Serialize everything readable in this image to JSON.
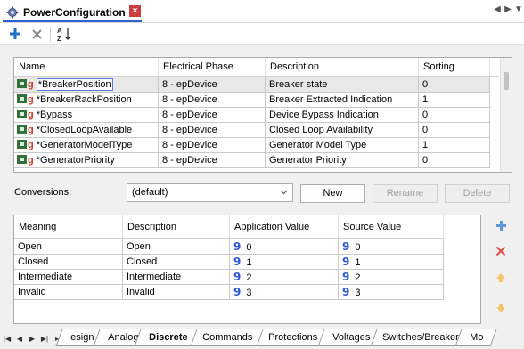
{
  "window": {
    "tab_title": "PowerConfiguration",
    "close_glyph": "×"
  },
  "icons": {
    "doc": "gear-icon",
    "add": "plus-icon",
    "delete": "x-icon",
    "sort": "sort-az-icon",
    "tag": "tag-icon",
    "value": "value-glyph-icon"
  },
  "toolbar": {
    "sort_label": "A Z"
  },
  "grid": {
    "headers": [
      "Name",
      "Electrical Phase",
      "Description",
      "Sorting"
    ],
    "rows": [
      {
        "name": "*BreakerPosition",
        "phase": "8 - epDevice",
        "description": "Breaker state",
        "sorting": "0",
        "selected": true
      },
      {
        "name": "*BreakerRackPosition",
        "phase": "8 - epDevice",
        "description": "Breaker Extracted Indication",
        "sorting": "1"
      },
      {
        "name": "*Bypass",
        "phase": "8 - epDevice",
        "description": "Device Bypass Indication",
        "sorting": "0"
      },
      {
        "name": "*ClosedLoopAvailable",
        "phase": "8 - epDevice",
        "description": "Closed Loop Availability",
        "sorting": "0"
      },
      {
        "name": "*GeneratorModelType",
        "phase": "8 - epDevice",
        "description": "Generator Model Type",
        "sorting": "1"
      },
      {
        "name": "*GeneratorPriority",
        "phase": "8 - epDevice",
        "description": "Generator Priority",
        "sorting": "0"
      }
    ],
    "glyph": "g"
  },
  "conversions": {
    "label": "Conversions:",
    "selected": "(default)",
    "new_label": "New",
    "rename_label": "Rename",
    "delete_label": "Delete"
  },
  "conv_grid": {
    "headers": [
      "Meaning",
      "Description",
      "Application Value",
      "Source Value"
    ],
    "rows": [
      {
        "meaning": "Open",
        "description": "Open",
        "app": "0",
        "src": "0"
      },
      {
        "meaning": "Closed",
        "description": "Closed",
        "app": "1",
        "src": "1"
      },
      {
        "meaning": "Intermediate",
        "description": "Intermediate",
        "app": "2",
        "src": "2"
      },
      {
        "meaning": "Invalid",
        "description": "Invalid",
        "app": "3",
        "src": "3"
      }
    ],
    "value_glyph": "9"
  },
  "sheet_tabs": [
    "esign",
    "Analog",
    "Discrete",
    "Commands",
    "Protections",
    "Voltages",
    "Switches/Breakers",
    "Mo"
  ],
  "active_sheet": "Discrete",
  "colors": {
    "accent": "#2f5fcf",
    "close": "#cc3d3d",
    "value_glyph": "#2f56d6",
    "tag_glyph": "#c33b2a"
  }
}
